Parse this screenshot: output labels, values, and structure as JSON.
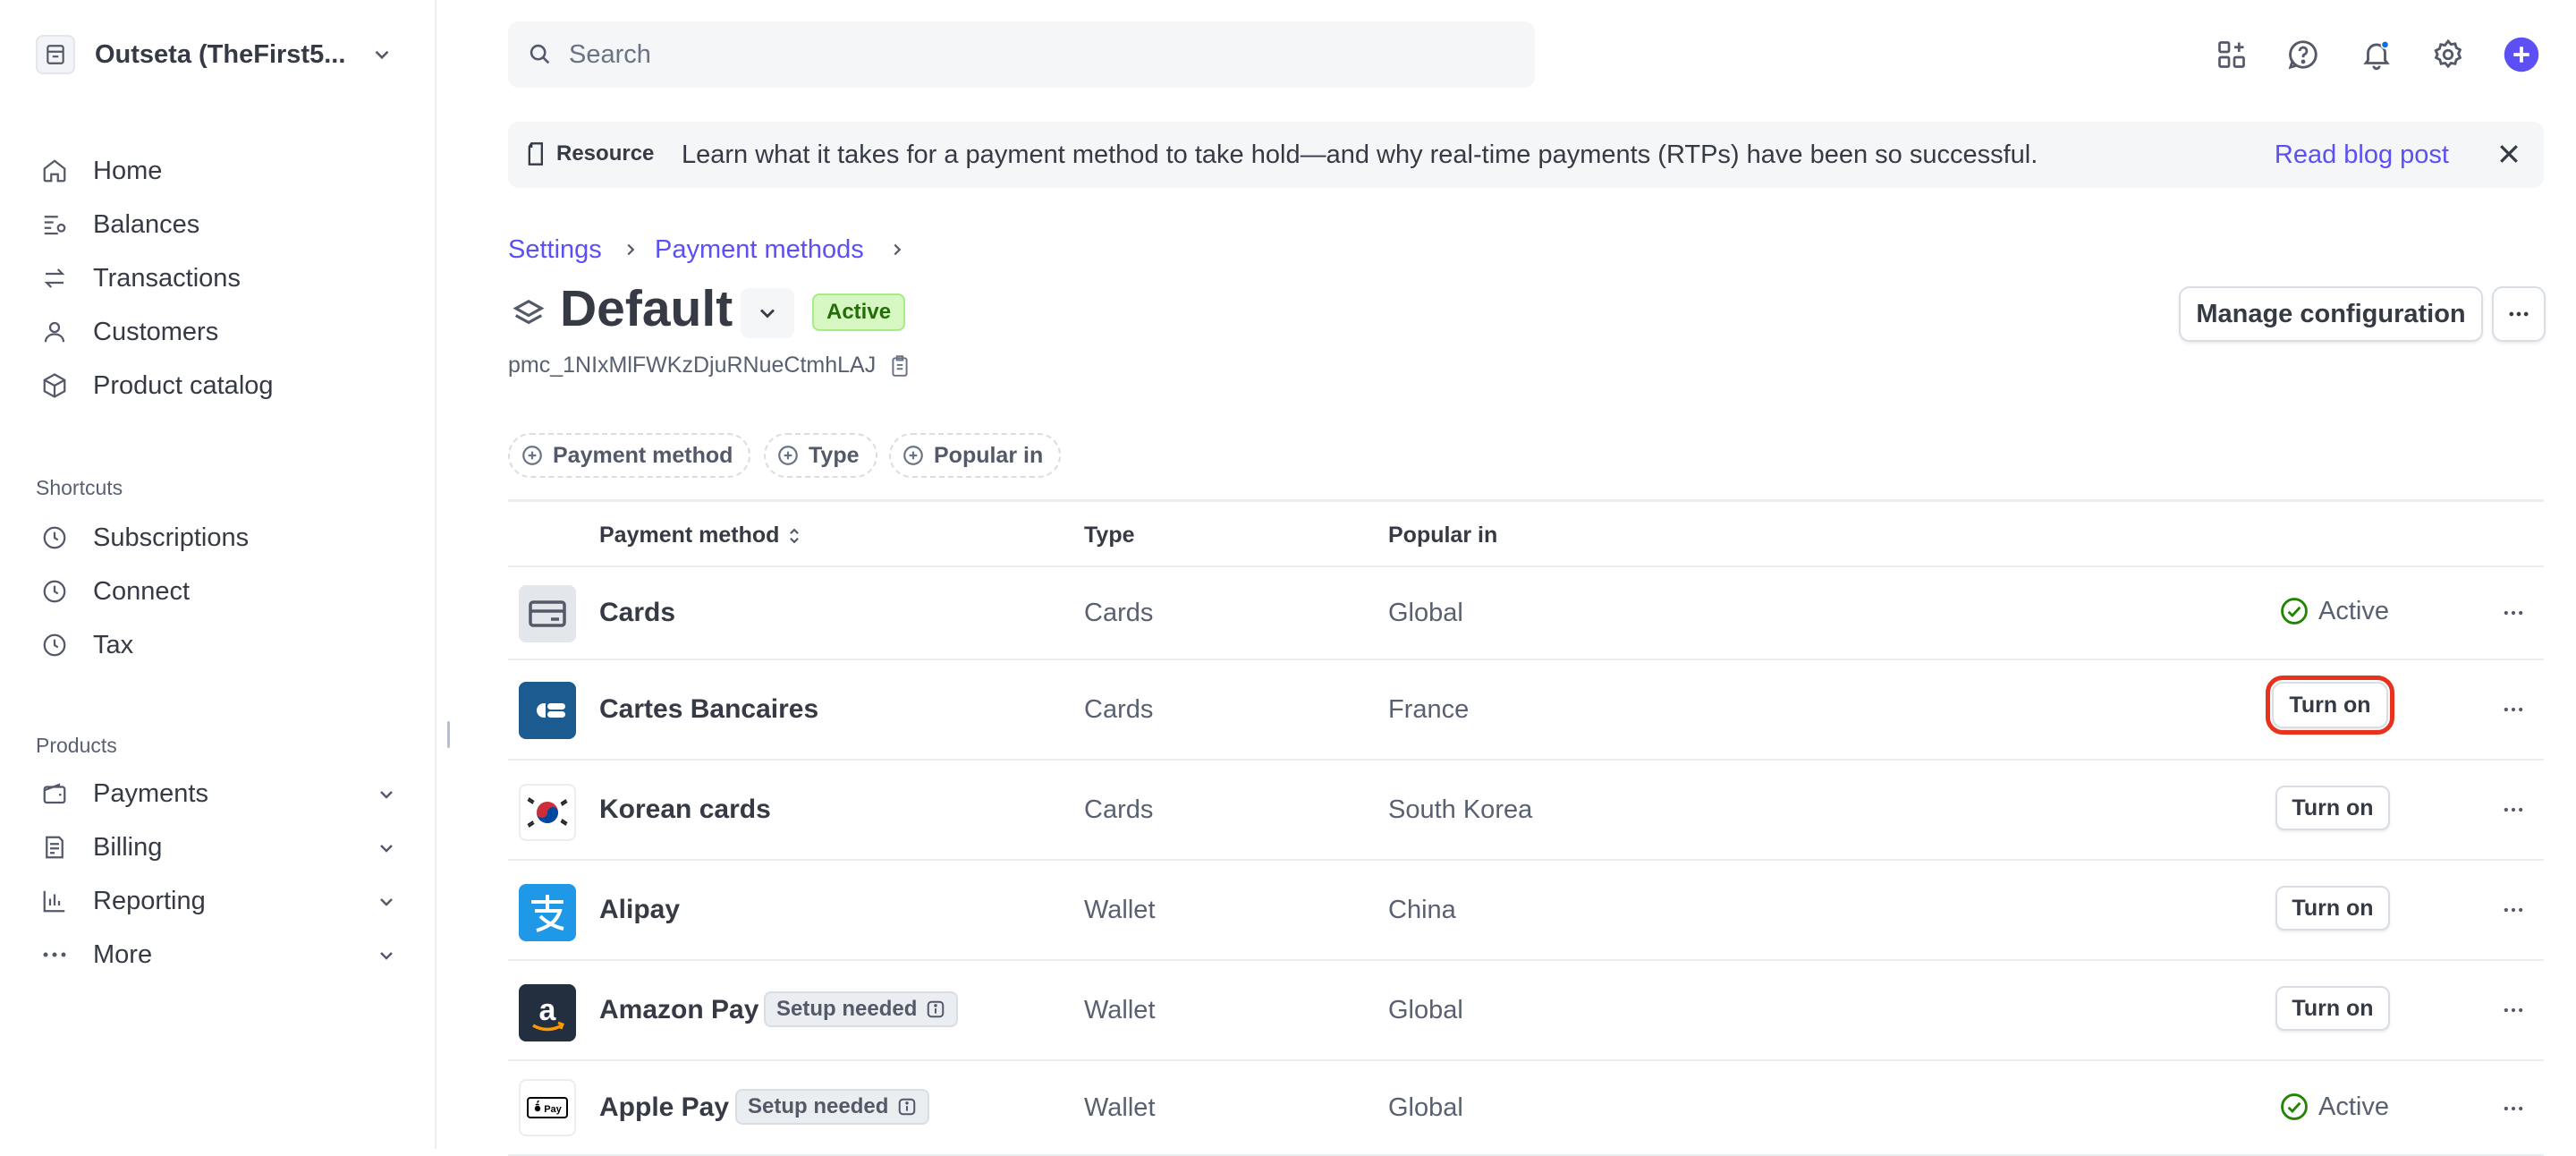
{
  "sidebar": {
    "account_name": "Outseta (TheFirst5...",
    "main_items": [
      {
        "label": "Home",
        "icon": "home-icon"
      },
      {
        "label": "Balances",
        "icon": "balances-icon"
      },
      {
        "label": "Transactions",
        "icon": "transactions-icon"
      },
      {
        "label": "Customers",
        "icon": "customers-icon"
      },
      {
        "label": "Product catalog",
        "icon": "product-catalog-icon"
      }
    ],
    "shortcuts_title": "Shortcuts",
    "shortcuts": [
      {
        "label": "Subscriptions",
        "icon": "clock-icon"
      },
      {
        "label": "Connect",
        "icon": "clock-icon"
      },
      {
        "label": "Tax",
        "icon": "clock-icon"
      }
    ],
    "products_title": "Products",
    "products": [
      {
        "label": "Payments",
        "icon": "wallet-icon"
      },
      {
        "label": "Billing",
        "icon": "billing-icon"
      },
      {
        "label": "Reporting",
        "icon": "reporting-icon"
      },
      {
        "label": "More",
        "icon": "more-dots-icon"
      }
    ]
  },
  "topbar": {
    "search_placeholder": "Search",
    "icons": [
      "apps-icon",
      "help-icon",
      "notifications-icon",
      "settings-icon",
      "create-plus-icon"
    ]
  },
  "banner": {
    "tag": "Resource",
    "message": "Learn what it takes for a payment method to take hold—and why real-time payments (RTPs) have been so successful.",
    "link": "Read blog post"
  },
  "breadcrumb": [
    "Settings",
    "Payment methods"
  ],
  "header": {
    "title": "Default",
    "status": "Active",
    "config_id": "pmc_1NIxMlFWKzDjuRNueCtmhLAJ",
    "manage_button": "Manage configuration"
  },
  "filters": [
    "Payment method",
    "Type",
    "Popular in"
  ],
  "table": {
    "columns": [
      "Payment method",
      "Type",
      "Popular in"
    ],
    "rows": [
      {
        "name": "Cards",
        "type": "Cards",
        "popular_in": "Global",
        "status": "Active",
        "badge": null,
        "logo": "card-icon"
      },
      {
        "name": "Cartes Bancaires",
        "type": "Cards",
        "popular_in": "France",
        "status": "Turn on",
        "badge": null,
        "logo": "cartes-bancaires-logo"
      },
      {
        "name": "Korean cards",
        "type": "Cards",
        "popular_in": "South Korea",
        "status": "Turn on",
        "badge": null,
        "logo": "korea-flag-icon"
      },
      {
        "name": "Alipay",
        "type": "Wallet",
        "popular_in": "China",
        "status": "Turn on",
        "badge": null,
        "logo": "alipay-logo"
      },
      {
        "name": "Amazon Pay",
        "type": "Wallet",
        "popular_in": "Global",
        "status": "Turn on",
        "badge": "Setup needed",
        "logo": "amazon-pay-logo"
      },
      {
        "name": "Apple Pay",
        "type": "Wallet",
        "popular_in": "Global",
        "status": "Active",
        "badge": "Setup needed",
        "logo": "apple-pay-logo"
      }
    ]
  },
  "colors": {
    "accent": "#5b4ff5",
    "active_green": "#217005",
    "highlight_red": "#e8321e"
  }
}
